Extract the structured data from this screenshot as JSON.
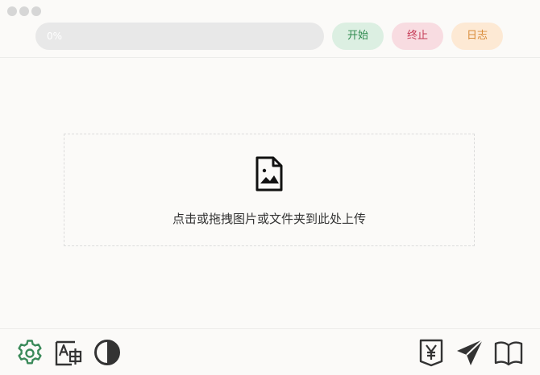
{
  "window": {
    "controls": [
      "close",
      "minimize",
      "maximize"
    ]
  },
  "progress": {
    "value": 0,
    "label": "0%",
    "fill_color": "#8fc9a3",
    "track_color": "#e8e8e8"
  },
  "actions": {
    "start_label": "开始",
    "stop_label": "终止",
    "log_label": "日志",
    "colors": {
      "start": "#2f8a4f",
      "stop": "#c53a55",
      "log": "#d98c3a"
    }
  },
  "upload": {
    "icon": "image-file-icon",
    "prompt": "点击或拖拽图片或文件夹到此处上传"
  },
  "bottom_toolbar": {
    "left_icons": [
      "gear-icon",
      "font-size-icon",
      "contrast-icon"
    ],
    "right_icons": [
      "yuan-download-icon",
      "send-icon",
      "book-icon"
    ],
    "accent_color": "#3b8a5a",
    "icon_color": "#333333"
  }
}
